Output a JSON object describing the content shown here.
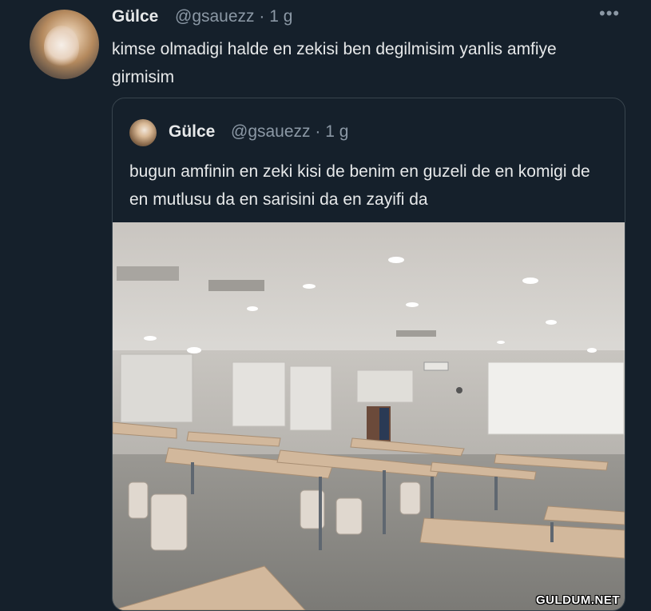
{
  "tweet": {
    "display_name": "Gülce",
    "handle_time": "@gsauezz · 1 g",
    "more_icon": "more-horizontal-icon",
    "text": "kimse olmadigi halde en zekisi ben degilmisim yanlis amfiye girmisim"
  },
  "quoted_tweet": {
    "display_name": "Gülce",
    "handle_time": "@gsauezz · 1 g",
    "text": "bugun amfinin en zeki kisi de benim en guzeli de en komigi de en mutlusu da en sarisini da en zayifi da",
    "image": {
      "subject": "empty lecture hall with rows of desks",
      "watermark": "GULDUM.NET"
    }
  },
  "colors": {
    "background": "#15202b",
    "text_primary": "#e7e9ea",
    "text_secondary": "#8b98a5",
    "border": "#38444d"
  }
}
